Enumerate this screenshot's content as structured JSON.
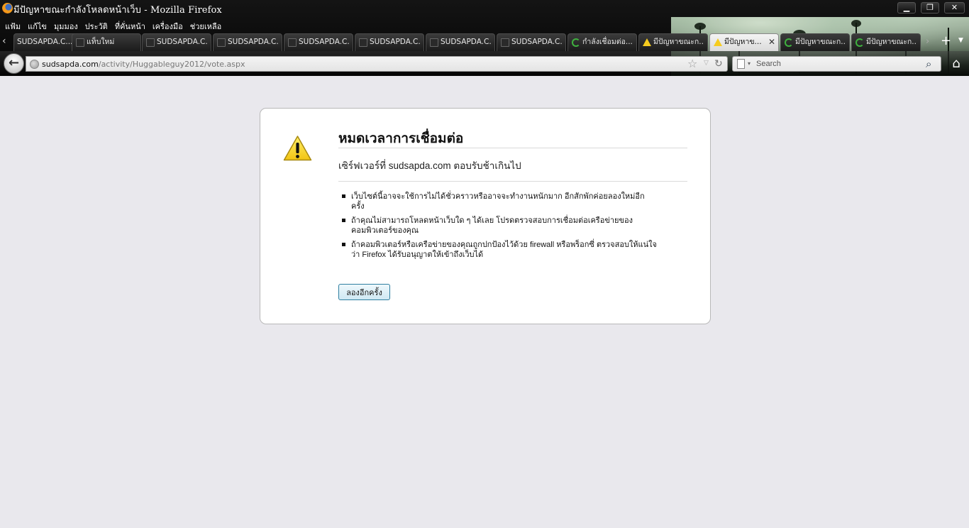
{
  "window": {
    "title": "มีปัญหาขณะกำลังโหลดหน้าเว็บ - Mozilla Firefox",
    "controls": {
      "minimize": "▁",
      "maximize": "❐",
      "close": "✕"
    }
  },
  "menubar": [
    "แฟ้ม",
    "แก้ไข",
    "มุมมอง",
    "ประวัติ",
    "ที่คั่นหน้า",
    "เครื่องมือ",
    "ช่วยเหลือ"
  ],
  "tabs": [
    {
      "label": "SUDSAPDA.C...",
      "icon": "blank-page-icon"
    },
    {
      "label": "แท็บใหม่",
      "icon": "blank-page-icon"
    },
    {
      "label": "SUDSAPDA.C...",
      "icon": "blank-page-icon"
    },
    {
      "label": "SUDSAPDA.C...",
      "icon": "blank-page-icon"
    },
    {
      "label": "SUDSAPDA.C...",
      "icon": "blank-page-icon"
    },
    {
      "label": "SUDSAPDA.C...",
      "icon": "blank-page-icon"
    },
    {
      "label": "SUDSAPDA.C...",
      "icon": "blank-page-icon"
    },
    {
      "label": "SUDSAPDA.C...",
      "icon": "blank-page-icon"
    },
    {
      "label": "กำลังเชื่อมต่อ...",
      "icon": "loading-spinner-icon"
    },
    {
      "label": "มีปัญหาขณะก...",
      "icon": "warning-icon"
    },
    {
      "label": "มีปัญหาข...",
      "icon": "warning-icon",
      "selected": true,
      "close": "✕"
    },
    {
      "label": "มีปัญหาขณะก...",
      "icon": "loading-spinner-icon"
    },
    {
      "label": "มีปัญหาขณะก...",
      "icon": "loading-spinner-icon"
    }
  ],
  "tabstrip": {
    "scroll_left": "‹",
    "scroll_right": "›",
    "new_tab": "+",
    "list_all": "▼"
  },
  "navbar": {
    "back": "←",
    "url_host": "sudsapda.com",
    "url_path": "/activity/Huggableguy2012/vote.aspx",
    "star": "☆",
    "dropmarker": "▽",
    "reload": "↻",
    "search_placeholder": "Search",
    "search_engine_drop": "▾",
    "search_go": "⌕",
    "home": "⌂"
  },
  "error_page": {
    "title": "หมดเวลาการเชื่อมต่อ",
    "short_desc": "เซิร์ฟเวอร์ที่ sudsapda.com ตอบรับช้าเกินไป",
    "bullets": [
      "เว็บไซต์นี้อาจจะใช้การไม่ได้ชั่วคราวหรืออาจจะทำงานหนักมาก อีกสักพักค่อยลองใหม่อีกครั้ง",
      "ถ้าคุณไม่สามารถโหลดหน้าเว็บใด ๆ ได้เลย โปรดตรวจสอบการเชื่อมต่อเครือข่ายของคอมพิวเตอร์ของคุณ",
      "ถ้าคอมพิวเตอร์หรือเครือข่ายของคุณถูกปกป้องไว้ด้วย firewall หรือพร็อกซี่ ตรวจสอบให้แน่ใจว่า Firefox ได้รับอนุญาตให้เข้าถึงเว็บได้"
    ],
    "try_again": "ลองอีกครั้ง"
  },
  "colors": {
    "page_background": "#e9e8ed",
    "chrome_background": "#0a0a0a",
    "warning_yellow": "#f6cc1f",
    "button_border": "#2f7fa0"
  }
}
